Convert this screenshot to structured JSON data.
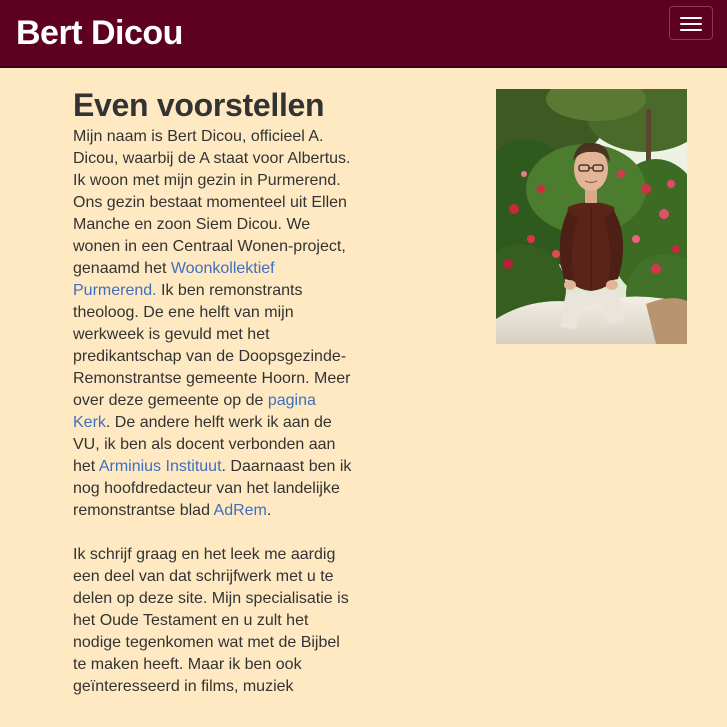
{
  "navbar": {
    "brand": "Bert Dicou",
    "toggle_icon": "hamburger-menu-icon"
  },
  "main": {
    "heading": "Even voorstellen",
    "paragraph1": {
      "t1": "Mijn naam is Bert Dicou, officieel A. Dicou, waarbij de A staat voor Albertus.",
      "t2": "Ik woon met mijn gezin in Purmerend. Ons gezin bestaat momenteel uit Ellen Manche en zoon Siem Dicou. We wonen in een Centraal Wonen-project, genaamd het ",
      "link1": "Woonkollektief Purmerend.",
      "t3": " Ik ben remonstrants theoloog. De ene helft van mijn werkweek is gevuld met het predikantschap van de Doopsgezinde-Remonstrantse gemeente Hoorn. Meer over deze gemeente op de ",
      "link2": "pagina Kerk",
      "t4": ". De andere helft werk ik aan de VU, ik ben als docent verbonden aan het ",
      "link3": "Arminius Instituut",
      "t5": ". Daarnaast ben ik nog hoofdredacteur van het landelijke remonstrantse blad ",
      "link4": "AdRem",
      "t6": "."
    },
    "paragraph2": "Ik schrijf graag en het leek me aardig een deel van dat schrijfwerk met u te delen op deze site. Mijn specialisatie is het Oude Testament en u zult het nodige tegenkomen wat met de Bijbel te maken heeft. Maar ik ben ook geïnteresseerd in films, muziek"
  },
  "colors": {
    "navbar": "#5e0020",
    "background": "#fee9c2",
    "link": "#3f6fbf",
    "text": "#333333"
  }
}
